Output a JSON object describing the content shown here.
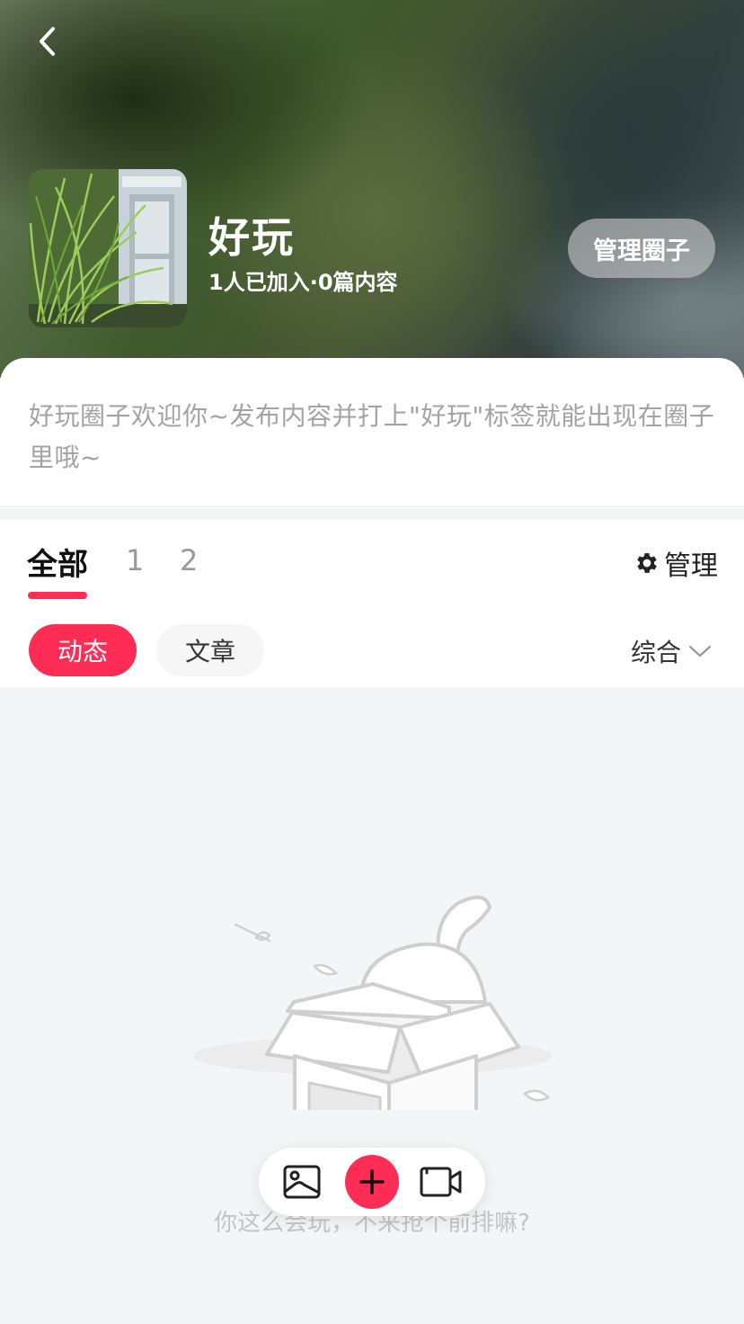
{
  "header": {
    "back_icon": "chevron-left-icon",
    "title": "好玩",
    "stats": "1人已加入·0篇内容",
    "manage_button_label": "管理圈子"
  },
  "intro": {
    "text": "好玩圈子欢迎你~发布内容并打上\"好玩\"标签就能出现在圈子里哦~"
  },
  "tabs": [
    {
      "label": "全部",
      "active": true
    },
    {
      "label": "1",
      "active": false
    },
    {
      "label": "2",
      "active": false
    }
  ],
  "manage_link": {
    "icon": "gear-icon",
    "label": "管理"
  },
  "filters": {
    "chips": [
      {
        "label": "动态",
        "selected": true
      },
      {
        "label": "文章",
        "selected": false
      }
    ],
    "sort": {
      "label": "综合",
      "icon": "chevron-down-icon"
    }
  },
  "empty_state": {
    "illustration": "empty-box-illustration",
    "text": "你这么会玩，不来抢个前排嘛?"
  },
  "post_bar": {
    "image_icon": "image-icon",
    "add_icon": "plus-icon",
    "video_icon": "video-camera-icon"
  },
  "colors": {
    "accent": "#ff2d55",
    "muted_text": "#a3a3a3",
    "background": "#f4f5f7"
  }
}
